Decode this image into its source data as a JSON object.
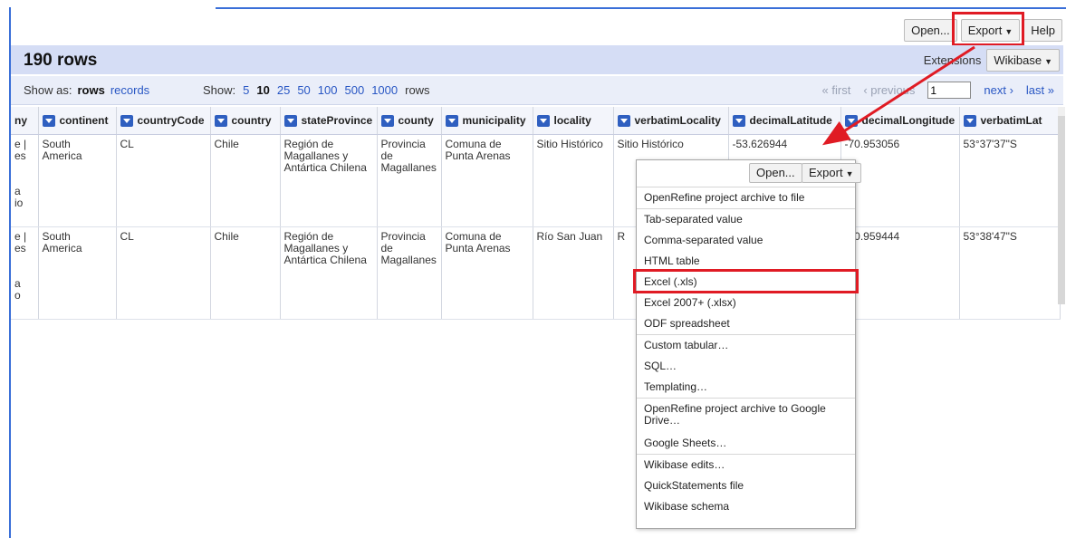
{
  "toolbar": {
    "open_label": "Open...",
    "export_label": "Export",
    "help_label": "Help"
  },
  "header": {
    "rows_count": "190 rows",
    "extensions_label": "Extensions",
    "wikibase_label": "Wikibase"
  },
  "view": {
    "show_as_label": "Show as:",
    "rows_label": "rows",
    "records_label": "records",
    "show_label": "Show:",
    "page_sizes": [
      "5",
      "10",
      "25",
      "50",
      "100",
      "500",
      "1000"
    ],
    "selected_page_size": "10",
    "rows_suffix": "rows"
  },
  "pager": {
    "first_label": "« first",
    "previous_label": "‹ previous",
    "page_value": "1",
    "next_label": "next ›",
    "last_label": "last »"
  },
  "table": {
    "columns": [
      "ny",
      "continent",
      "countryCode",
      "country",
      "stateProvince",
      "county",
      "municipality",
      "locality",
      "verbatimLocality",
      "decimalLatitude",
      "decimalLongitude",
      "verbatimLat"
    ],
    "rows": [
      {
        "c0": "e |\nes\n\n\na\nio",
        "continent": "South America",
        "countryCode": "CL",
        "country": "Chile",
        "stateProvince": "Región de Magallanes y Antártica Chilena",
        "county": "Provincia de Magallanes",
        "municipality": "Comuna de Punta Arenas",
        "locality": "Sitio Histórico",
        "verbatimLocality": "Sitio Histórico",
        "decimalLatitude": "-53.626944",
        "decimalLongitude": "-70.953056",
        "verbatimLat": "53°37'37\"S"
      },
      {
        "c0": "e |\nes\n\n\na\no",
        "continent": "South America",
        "countryCode": "CL",
        "country": "Chile",
        "stateProvince": "Región de Magallanes y Antártica Chilena",
        "county": "Provincia de Magallanes",
        "municipality": "Comuna de Punta Arenas",
        "locality": "Río San Juan",
        "verbatimLocality": "R",
        "decimalLatitude": "",
        "decimalLongitude": "-70.959444",
        "verbatimLat": "53°38'47\"S"
      }
    ]
  },
  "export_menu": {
    "open_label": "Open...",
    "export_label": "Export",
    "groups": [
      [
        "OpenRefine project archive to file"
      ],
      [
        "Tab-separated value",
        "Comma-separated value",
        "HTML table",
        "Excel (.xls)",
        "Excel 2007+ (.xlsx)",
        "ODF spreadsheet"
      ],
      [
        "Custom tabular…",
        "SQL…",
        "Templating…"
      ],
      [
        "OpenRefine project archive to Google Drive…",
        "Google Sheets…"
      ],
      [
        "Wikibase edits…",
        "QuickStatements file",
        "Wikibase schema"
      ]
    ]
  },
  "colors": {
    "accent_blue": "#3a6fd8",
    "highlight_red": "#e01b24",
    "header_bar": "#d5ddf5",
    "link": "#2957c4"
  }
}
